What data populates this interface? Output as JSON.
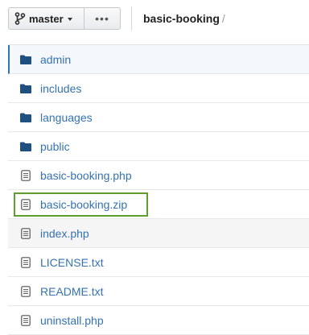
{
  "toolbar": {
    "branch_label": "master",
    "more_label": "•••",
    "breadcrumb_repo": "basic-booking",
    "breadcrumb_sep": "/"
  },
  "files": [
    {
      "name": "admin",
      "icon": "folder-icon",
      "type": "folder"
    },
    {
      "name": "includes",
      "icon": "folder-icon",
      "type": "folder"
    },
    {
      "name": "languages",
      "icon": "folder-icon",
      "type": "folder"
    },
    {
      "name": "public",
      "icon": "folder-icon",
      "type": "folder"
    },
    {
      "name": "basic-booking.php",
      "icon": "file-icon",
      "type": "file"
    },
    {
      "name": "basic-booking.zip",
      "icon": "file-icon",
      "type": "file"
    },
    {
      "name": "index.php",
      "icon": "file-icon",
      "type": "file"
    },
    {
      "name": "LICENSE.txt",
      "icon": "file-icon",
      "type": "file"
    },
    {
      "name": "README.txt",
      "icon": "file-icon",
      "type": "file"
    },
    {
      "name": "uninstall.php",
      "icon": "file-icon",
      "type": "file"
    }
  ],
  "colors": {
    "link": "#3572b0",
    "folder": "#205081",
    "highlight": "#5e9e31"
  }
}
